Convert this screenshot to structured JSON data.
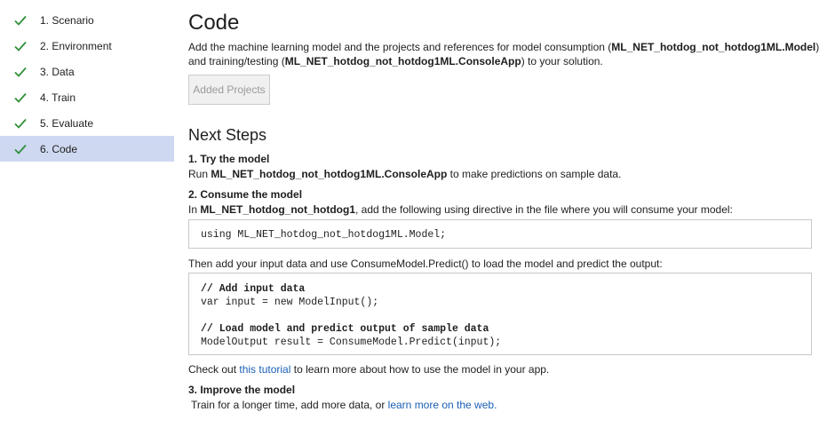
{
  "sidebar": {
    "steps": [
      {
        "label": "1. Scenario"
      },
      {
        "label": "2. Environment"
      },
      {
        "label": "3. Data"
      },
      {
        "label": "4. Train"
      },
      {
        "label": "5. Evaluate"
      },
      {
        "label": "6. Code"
      }
    ],
    "active_index": 5,
    "check_color": "#2f8f3a",
    "active_bg": "#cfd8f1"
  },
  "main": {
    "title": "Code",
    "desc": {
      "part1": "Add the machine learning model and the projects and references for model consumption (",
      "model_project": "ML_NET_hotdog_not_hotdog1ML.Model",
      "part2": ")",
      "part3": "and training/testing (",
      "console_project": "ML_NET_hotdog_not_hotdog1ML.ConsoleApp",
      "part4": ") to your solution."
    },
    "added_projects_button": "Added Projects",
    "next_steps_heading": "Next Steps",
    "try": {
      "heading": "1. Try the model",
      "prefix": "Run ",
      "project": "ML_NET_hotdog_not_hotdog1ML.ConsoleApp",
      "suffix": " to make predictions on sample data."
    },
    "consume": {
      "heading": "2. Consume the model",
      "prefix": "In ",
      "project": "ML_NET_hotdog_not_hotdog1",
      "suffix": ", add the following using directive in the file where you will consume your model:",
      "using_code": "using ML_NET_hotdog_not_hotdog1ML.Model;",
      "then_text": "Then add your input data and use ConsumeModel.Predict() to load the model and predict the output:",
      "code_lines": [
        "// Add input data",
        "var input = new ModelInput();",
        "",
        "// Load model and predict output of sample data",
        "ModelOutput result = ConsumeModel.Predict(input);"
      ],
      "tutorial_prefix": "Check out ",
      "tutorial_link": "this tutorial",
      "tutorial_suffix": " to learn more about how to use the model in your app."
    },
    "improve": {
      "heading": "3. Improve the model",
      "prefix": "Train for a longer time, add more data, or ",
      "link": "learn more on the web."
    },
    "link_color": "#1a5fb4"
  }
}
